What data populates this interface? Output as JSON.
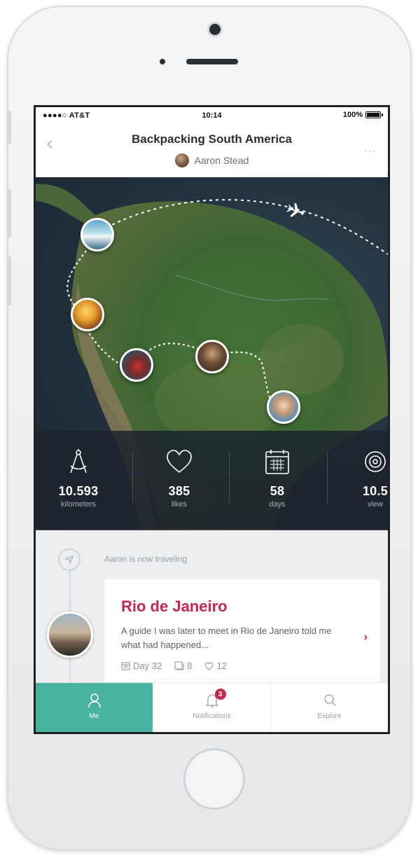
{
  "status_bar": {
    "carrier": "●●●●○ AT&T",
    "time": "10:14",
    "battery": "100%"
  },
  "nav": {
    "title": "Backpacking South America",
    "author": "Aaron Stead",
    "more": "···"
  },
  "stats": [
    {
      "icon": "compass-icon",
      "value": "10.593",
      "label": "kilometers"
    },
    {
      "icon": "heart-icon",
      "value": "385",
      "label": "likes"
    },
    {
      "icon": "calendar-icon",
      "value": "58",
      "label": "days"
    },
    {
      "icon": "eye-icon",
      "value": "10.5",
      "label": "view"
    }
  ],
  "feed": {
    "status_text": "Aaron is now traveling",
    "entry": {
      "title": "Rio de Janeiro",
      "text": "A guide I was later to meet in Rio de Janeiro told me what had happened...",
      "day": "Day 32",
      "photos": "8",
      "likes": "12"
    }
  },
  "tabs": [
    {
      "label": "Me",
      "icon": "person-icon",
      "active": true
    },
    {
      "label": "Notifications",
      "icon": "bell-icon",
      "badge": "3"
    },
    {
      "label": "Explore",
      "icon": "search-icon"
    }
  ],
  "colors": {
    "accent": "#48b3a0",
    "highlight": "#c7274f",
    "stats_bg": "#1c232c"
  }
}
